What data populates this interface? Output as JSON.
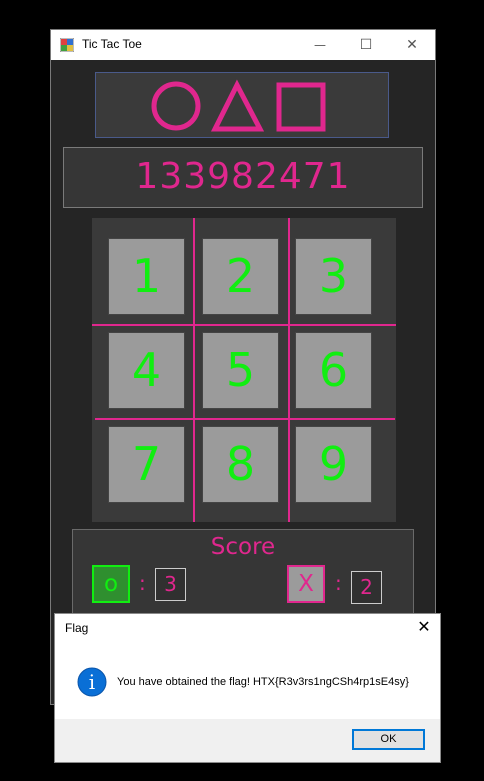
{
  "window": {
    "title": "Tic Tac Toe",
    "minimize_glyph": "—",
    "maximize_glyph": "☐",
    "close_glyph": "✕"
  },
  "logo": {
    "shapes": [
      "circle",
      "triangle",
      "square"
    ],
    "color": "#e0278e"
  },
  "number_display": {
    "value": "133982471"
  },
  "board": {
    "cells": [
      "1",
      "2",
      "3",
      "4",
      "5",
      "6",
      "7",
      "8",
      "9"
    ],
    "line_color": "#e0278e",
    "cell_text_color": "#11ee11"
  },
  "score": {
    "title": "Score",
    "player_o": {
      "symbol": "o",
      "separator": ":",
      "value": "3"
    },
    "player_x": {
      "symbol": "X",
      "separator": ":",
      "value": "2"
    }
  },
  "dialog": {
    "title": "Flag",
    "close_glyph": "✕",
    "message": "You have obtained the flag! HTX{R3v3rs1ngCSh4rp1sE4sy}",
    "ok_label": "OK",
    "info_glyph": "i"
  }
}
